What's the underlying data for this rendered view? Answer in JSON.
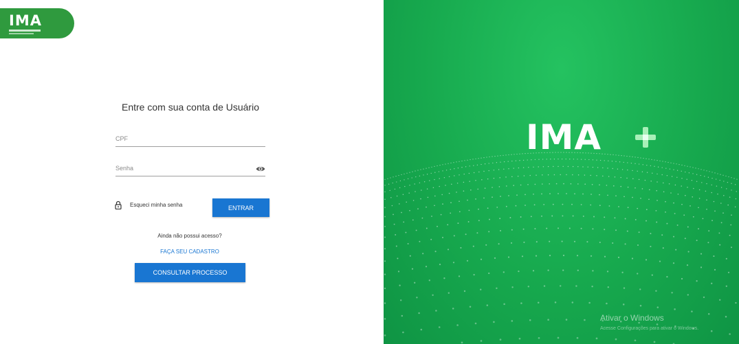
{
  "logo": {
    "text": "IMA",
    "icon": "ima-logo"
  },
  "login": {
    "title": "Entre com sua conta de Usuário",
    "cpf_placeholder": "CPF",
    "password_placeholder": "Senha",
    "show_password_icon": "eye-icon",
    "forgot_icon": "lock-icon",
    "forgot_password": "Esqueci minha senha",
    "submit_label": "ENTRAR",
    "no_access": "Ainda não possui acesso?",
    "register_link": "FAÇA SEU CADASTRO",
    "consult_label": "CONSULTAR PROCESSO"
  },
  "brand": {
    "text": "IMA",
    "icon": "plus-icon"
  },
  "watermark": {
    "title": "Ativar o Windows",
    "subtitle": "Acesse Configurações para ativar o Windows."
  },
  "colors": {
    "primary_blue": "#1976d2",
    "brand_green": "#17a94e",
    "logo_green": "#2f9a3e",
    "plus_light": "#a8f0b8"
  }
}
